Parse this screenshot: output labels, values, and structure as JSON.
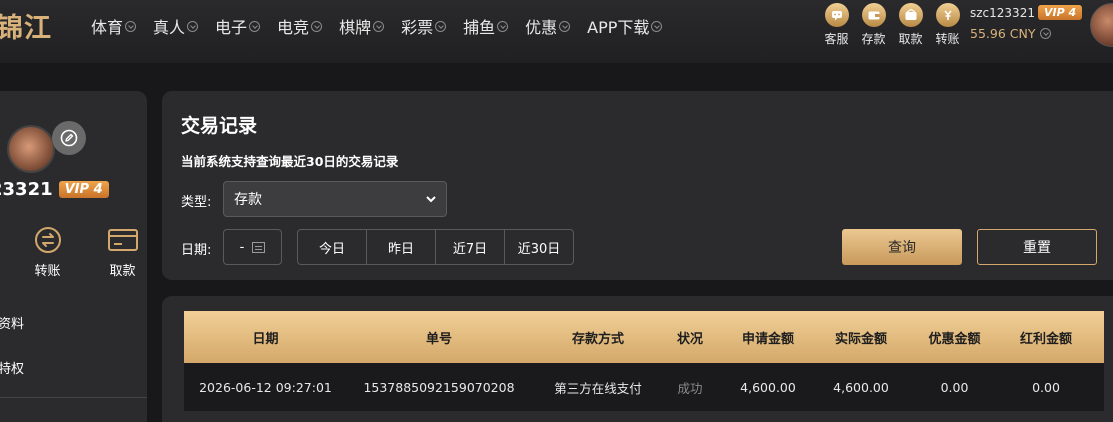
{
  "header": {
    "logo": "锦江",
    "nav": [
      "体育",
      "真人",
      "电子",
      "电竞",
      "棋牌",
      "彩票",
      "捕鱼",
      "优惠",
      "APP下载"
    ],
    "quick_icons": [
      {
        "label": "客服",
        "icon": "customer-service-icon"
      },
      {
        "label": "存款",
        "icon": "deposit-wallet-icon"
      },
      {
        "label": "取款",
        "icon": "withdraw-wallet-icon"
      },
      {
        "label": "转账",
        "icon": "transfer-coin-icon"
      }
    ],
    "username": "szc123321",
    "vip": "VIP 4",
    "balance": "55.96 CNY"
  },
  "sidebar": {
    "username": "23321",
    "vip": "VIP 4",
    "actions": [
      "转账",
      "取款"
    ],
    "links": [
      "资料",
      "特权"
    ]
  },
  "filter": {
    "title": "交易记录",
    "note": "当前系统支持查询最近30日的交易记录",
    "type_label": "类型:",
    "type_value": "存款",
    "date_label": "日期:",
    "date_value": "-",
    "quick_ranges": [
      "今日",
      "昨日",
      "近7日",
      "近30日"
    ],
    "query_label": "查询",
    "reset_label": "重置"
  },
  "table": {
    "columns": [
      "日期",
      "单号",
      "存款方式",
      "状况",
      "申请金额",
      "实际金额",
      "优惠金额",
      "红利金额"
    ],
    "rows": [
      [
        "2026-06-12 09:27:01",
        "1537885092159070208",
        "第三方在线支付",
        "成功",
        "4,600.00",
        "4,600.00",
        "0.00",
        "0.00"
      ]
    ]
  }
}
